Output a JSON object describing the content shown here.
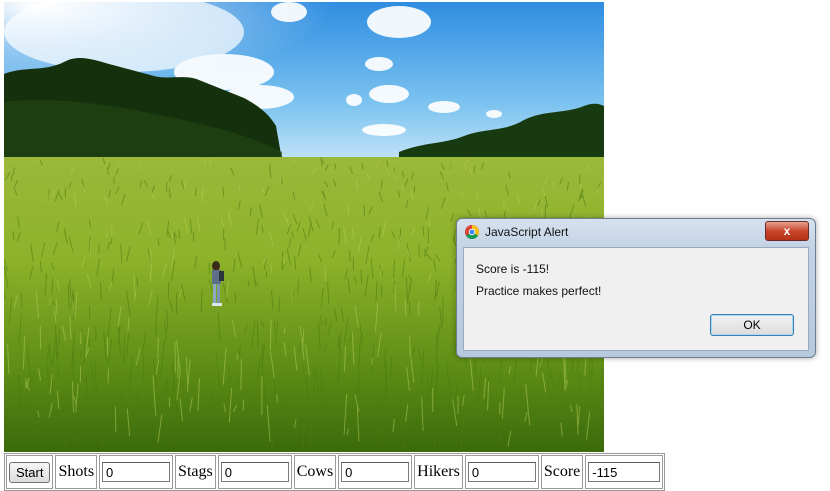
{
  "controls": {
    "start_label": "Start",
    "shots_label": "Shots",
    "shots_value": "0",
    "stags_label": "Stags",
    "stags_value": "0",
    "cows_label": "Cows",
    "cows_value": "0",
    "hikers_label": "Hikers",
    "hikers_value": "0",
    "score_label": "Score",
    "score_value": "-115"
  },
  "alert": {
    "title": "JavaScript Alert",
    "close_glyph": "x",
    "line1": "Score is -115!",
    "line2": "Practice makes perfect!",
    "ok_label": "OK"
  },
  "scene": {
    "sky_color": "#5aaee8",
    "grass_color": "#7fa51e"
  }
}
